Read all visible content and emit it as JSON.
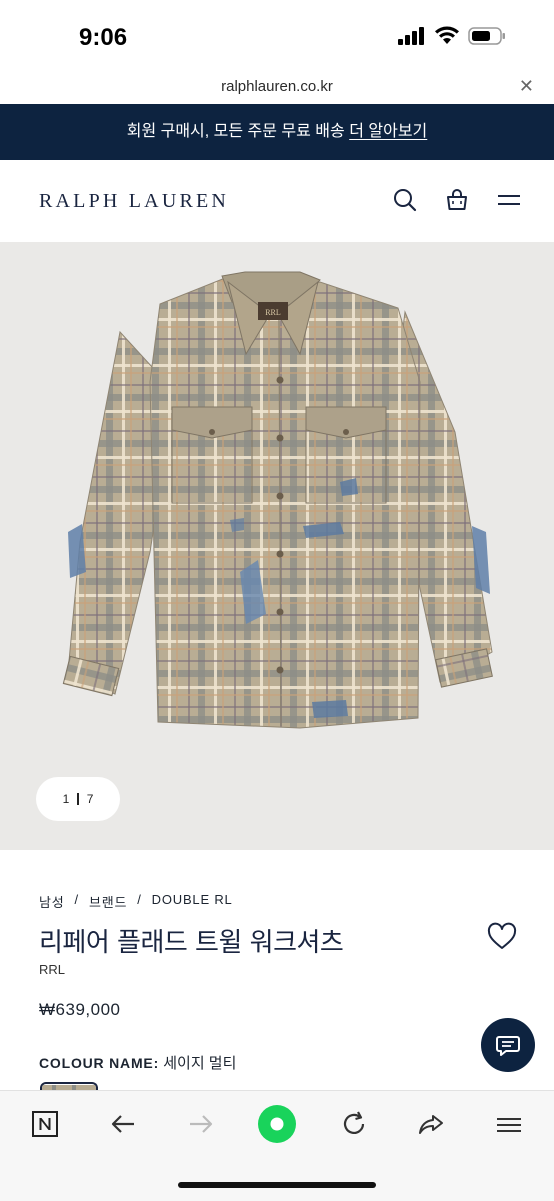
{
  "status_bar": {
    "time": "9:06"
  },
  "browser": {
    "url": "ralphlauren.co.kr"
  },
  "promo": {
    "text": "회원 구매시, 모든 주문 무료 배송",
    "link": "더 알아보기"
  },
  "header": {
    "logo": "RALPH LAUREN"
  },
  "gallery": {
    "current": "1",
    "total": "7"
  },
  "product": {
    "breadcrumb": [
      "남성",
      "브랜드",
      "DOUBLE RL"
    ],
    "title": "리페어 플래드 트윌 워크셔츠",
    "brand": "RRL",
    "price": "₩639,000",
    "colour_label": "COLOUR NAME:",
    "colour_value": "세이지 멀티"
  },
  "icons": {
    "header": [
      "search-icon",
      "shopping-bag-icon",
      "menu-icon"
    ],
    "toolbar": [
      "naver-n-icon",
      "back-arrow-icon",
      "forward-arrow-icon",
      "green-home-icon",
      "reload-icon",
      "share-icon",
      "menu-icon"
    ],
    "brand_colors": {
      "navy": "#0d2340",
      "gallery_bg": "#eae9e7",
      "green": "#19d35b"
    }
  }
}
